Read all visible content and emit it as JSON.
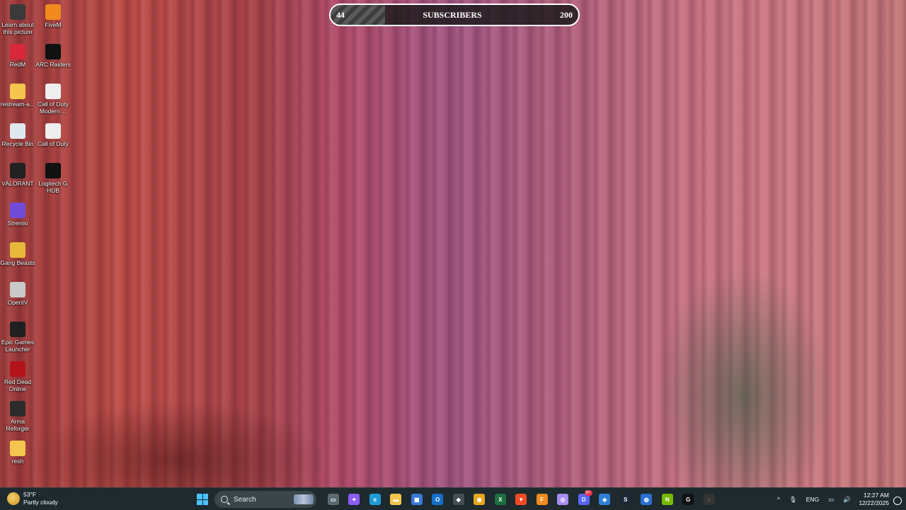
{
  "counter": {
    "current": "44",
    "label": "SUBSCRIBERS",
    "goal": "200",
    "progress_fraction": 0.22
  },
  "desktop_icons": [
    {
      "label": "Learn about this picture",
      "icon": "camera-icon",
      "color": "#3a3a3a"
    },
    {
      "label": "FiveM",
      "icon": "fivem-icon",
      "color": "#f28a1e"
    },
    {
      "label": "RedM",
      "icon": "redm-icon",
      "color": "#d8263a"
    },
    {
      "label": "ARC Raiders",
      "icon": "arc-raiders-icon",
      "color": "#111111"
    },
    {
      "label": "restream-a...",
      "icon": "folder-icon",
      "color": "#f4c64e"
    },
    {
      "label": "Call of Duty Modern ...",
      "icon": "file-icon",
      "color": "#eeeeee"
    },
    {
      "label": "Recycle Bin",
      "icon": "recycle-bin-icon",
      "color": "#dfe8ee"
    },
    {
      "label": "Call of Duty",
      "icon": "file-icon",
      "color": "#eeeeee"
    },
    {
      "label": "VALORANT",
      "icon": "valorant-icon",
      "color": "#222222"
    },
    {
      "label": "Logitech G HUB",
      "icon": "logitech-icon",
      "color": "#111111"
    },
    {
      "label": "Stremio",
      "icon": "stremio-icon",
      "color": "#6f4bd8"
    },
    {
      "label": "Gang Beasts",
      "icon": "gang-beasts-icon",
      "color": "#e7b93b"
    },
    {
      "label": "OpenIV",
      "icon": "openiv-icon",
      "color": "#c9c9c9"
    },
    {
      "label": "Epic Games Launcher",
      "icon": "epic-games-icon",
      "color": "#202020"
    },
    {
      "label": "Red Dead Online",
      "icon": "red-dead-icon",
      "color": "#b3141c"
    },
    {
      "label": "Arma Reforger",
      "icon": "arma-icon",
      "color": "#2b2b2b"
    },
    {
      "label": "resh",
      "icon": "folder-icon",
      "color": "#f4c64e"
    }
  ],
  "taskbar": {
    "weather_temp": "53°F",
    "weather_desc": "Partly cloudy",
    "search_label": "Search",
    "apps": [
      {
        "icon": "task-view-icon",
        "color": "#5b6a70",
        "glyph": "▭"
      },
      {
        "icon": "copilot-icon",
        "color": "#8b5cf6",
        "glyph": "✦"
      },
      {
        "icon": "edge-icon",
        "color": "#1f9bd8",
        "glyph": "e"
      },
      {
        "icon": "file-explorer-icon",
        "color": "#f4c64e",
        "glyph": "▬"
      },
      {
        "icon": "microsoft-store-icon",
        "color": "#3a78d8",
        "glyph": "▦"
      },
      {
        "icon": "outlook-icon",
        "color": "#1670c8",
        "glyph": "O"
      },
      {
        "icon": "app-cube-icon",
        "color": "#444f54",
        "glyph": "◆"
      },
      {
        "icon": "chrome-icon",
        "color": "#e5a71f",
        "glyph": "◉"
      },
      {
        "icon": "excel-icon",
        "color": "#1d6f42",
        "glyph": "X"
      },
      {
        "icon": "brave-icon",
        "color": "#f04c23",
        "glyph": "▼"
      },
      {
        "icon": "fivem-icon",
        "color": "#f28a1e",
        "glyph": "F"
      },
      {
        "icon": "soundpad-icon",
        "color": "#a88cf0",
        "glyph": "◎"
      },
      {
        "icon": "discord-icon",
        "color": "#5865f2",
        "glyph": "D",
        "badge": "9+"
      },
      {
        "icon": "app-blue-icon",
        "color": "#2f7fd8",
        "glyph": "◈"
      },
      {
        "icon": "steam-icon",
        "color": "#1b2838",
        "glyph": "S"
      },
      {
        "icon": "app-ring-icon",
        "color": "#2a6fd1",
        "glyph": "◍"
      },
      {
        "icon": "nvidia-icon",
        "color": "#76b900",
        "glyph": "N"
      },
      {
        "icon": "logitech-icon",
        "color": "#111111",
        "glyph": "G"
      },
      {
        "icon": "obs-icon",
        "color": "#333333",
        "glyph": "◌"
      }
    ],
    "language": "ENG",
    "time": "12:27 AM",
    "date": "12/22/2025"
  }
}
